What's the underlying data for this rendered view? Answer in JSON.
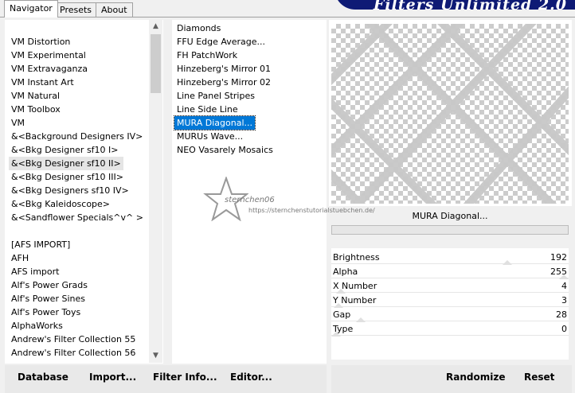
{
  "tabs": [
    {
      "label": "Navigator",
      "active": true
    },
    {
      "label": "Presets",
      "active": false
    },
    {
      "label": "About",
      "active": false
    }
  ],
  "banner_title": "Filters Unlimited 2.0",
  "categories": [
    "VM Distortion",
    "VM Experimental",
    "VM Extravaganza",
    "VM Instant Art",
    "VM Natural",
    "VM Toolbox",
    "VM",
    "&<Background Designers IV>",
    "&<Bkg Designer sf10 I>",
    "&<Bkg Designer sf10 II>",
    "&<Bkg Designer sf10 III>",
    "&<Bkg Designers sf10 IV>",
    "&<Bkg Kaleidoscope>",
    "&<Sandflower Specials^v^ >",
    "",
    "[AFS IMPORT]",
    "AFH",
    "AFS import",
    "Alf's Power Grads",
    "Alf's Power Sines",
    "Alf's Power Toys",
    "AlphaWorks",
    "Andrew's Filter Collection 55",
    "Andrew's Filter Collection 56"
  ],
  "selected_category_index": 9,
  "filters": [
    "Diamonds",
    "FFU Edge Average...",
    "FH PatchWork",
    "Hinzeberg's Mirror 01",
    "Hinzeberg's Mirror 02",
    "Line Panel Stripes",
    "Line Side Line",
    "MURA Diagonal...",
    "MURUs Wave...",
    "NEO Vasarely Mosaics"
  ],
  "selected_filter_index": 7,
  "watermark": {
    "name": "sternchen06",
    "url": "https://sternchenstutorialstuebchen.de/"
  },
  "preview_caption": "MURA Diagonal...",
  "params": [
    {
      "label": "Brightness",
      "value": "192",
      "level": 0.75
    },
    {
      "label": "Alpha",
      "value": "255",
      "level": 1.0
    },
    {
      "label": "X Number",
      "value": "4",
      "level": 0.02
    },
    {
      "label": "Y Number",
      "value": "3",
      "level": 0.01
    },
    {
      "label": "Gap",
      "value": "28",
      "level": 0.11
    },
    {
      "label": "Type",
      "value": "0",
      "level": 0.0
    }
  ],
  "buttons": {
    "database": "Database",
    "import": "Import...",
    "filter_info": "Filter Info...",
    "editor": "Editor...",
    "randomize": "Randomize",
    "reset": "Reset"
  },
  "colors": {
    "banner": "#0e1a75",
    "selection": "#0078d7"
  }
}
